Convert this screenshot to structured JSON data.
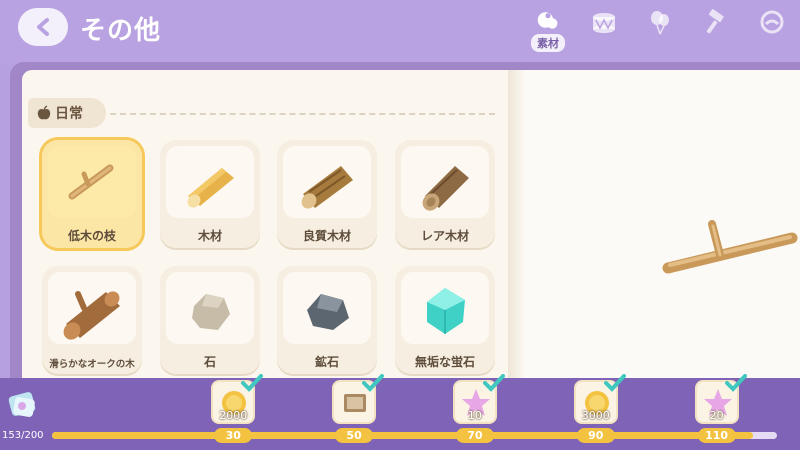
{
  "header": {
    "title": "その他",
    "tabs": [
      {
        "icon": "material-icon",
        "label": "素材",
        "active": true
      },
      {
        "icon": "drum-icon",
        "label": "",
        "active": false
      },
      {
        "icon": "balloon-icon",
        "label": "",
        "active": false
      },
      {
        "icon": "hammer-icon",
        "label": "",
        "active": false
      },
      {
        "icon": "compass-icon",
        "label": "",
        "active": false
      }
    ]
  },
  "section": {
    "icon": "apple-icon",
    "label": "日常"
  },
  "items": [
    {
      "name": "低木の枝",
      "icon": "twig-icon",
      "selected": true
    },
    {
      "name": "木材",
      "icon": "wood-icon",
      "selected": false
    },
    {
      "name": "良質木材",
      "icon": "quality-wood-icon",
      "selected": false
    },
    {
      "name": "レア木材",
      "icon": "rare-wood-icon",
      "selected": false
    },
    {
      "name": "滑らかなオークの木",
      "icon": "oak-log-icon",
      "selected": false
    },
    {
      "name": "石",
      "icon": "stone-icon",
      "selected": false
    },
    {
      "name": "鉱石",
      "icon": "ore-icon",
      "selected": false
    },
    {
      "name": "無垢な蛍石",
      "icon": "fluorite-icon",
      "selected": false
    }
  ],
  "preview": {
    "icon": "twig-icon"
  },
  "progress": {
    "count": "153/200",
    "current": 153,
    "max": 200,
    "track_min": 0,
    "track_max": 120,
    "fill_value": 116,
    "milestones": [
      {
        "label": "30",
        "value": 30,
        "reward_qty": "2000",
        "reward_icon": "coin-icon",
        "claimed": true
      },
      {
        "label": "50",
        "value": 50,
        "reward_qty": "",
        "reward_icon": "book-icon",
        "claimed": true
      },
      {
        "label": "70",
        "value": 70,
        "reward_qty": "10",
        "reward_icon": "star-icon",
        "claimed": true
      },
      {
        "label": "90",
        "value": 90,
        "reward_qty": "3000",
        "reward_icon": "coin-icon",
        "claimed": true
      },
      {
        "label": "110",
        "value": 110,
        "reward_qty": "20",
        "reward_icon": "star-icon",
        "claimed": true
      }
    ]
  },
  "colors": {
    "accent": "#b9a2e1",
    "bar": "#7e63b6",
    "progress": "#f3c240",
    "check": "#3fc7c0",
    "selected": "#fbe6a6"
  }
}
